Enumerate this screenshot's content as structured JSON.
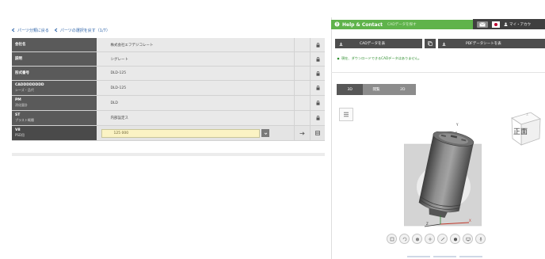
{
  "breadcrumbs": [
    {
      "label": "パーツ分類に戻る"
    },
    {
      "label": "パーツの選択を戻す（1/7）"
    }
  ],
  "params": {
    "rows": [
      {
        "name": "会社名",
        "sub": "",
        "value": "株式会社エフデジコレート"
      },
      {
        "name": "説明",
        "sub": "",
        "value": "シグレート"
      },
      {
        "name": "形式番号",
        "sub": "",
        "value": "DLD-125"
      },
      {
        "name": "CADDDDDDDD",
        "sub": "シーズ・品代",
        "value": "DLD-125"
      },
      {
        "name": "PM",
        "sub": "消化量計",
        "value": "DLD"
      },
      {
        "name": "ST",
        "sub": "プラスト概種",
        "value": "内部設定ス"
      }
    ],
    "input_row": {
      "name": "V8",
      "sub": "PSD用",
      "value": "125 000"
    }
  },
  "help": {
    "title": "Help & Contact",
    "subtitle": "CADデータを探す"
  },
  "header_right": {
    "mypage_label": "マイ・アカウ"
  },
  "cad": {
    "cad_button": "CADデータを表",
    "pdf_button": "PDFデータシートを表",
    "notice": "現在、ダウンロードできるCADデータはありません。"
  },
  "viewer": {
    "tabs": [
      "3D",
      "閲覧",
      "2D"
    ],
    "cube_label": "正面",
    "axes": {
      "y": "Y",
      "z": "Z",
      "x": "X"
    }
  },
  "colors": {
    "help_green": "#5fb34b",
    "header_dark": "#3f3f3f",
    "input_yellow": "#fbf3c4",
    "label_gray": "#5a5a5a"
  },
  "icons": [
    "back-arrow-icon",
    "lock-icon",
    "arrow-right-icon",
    "grid-icon",
    "question-icon",
    "mail-icon",
    "japan-flag-icon",
    "download-icon",
    "copy-icon",
    "view-cube-icon",
    "tool-icons"
  ]
}
